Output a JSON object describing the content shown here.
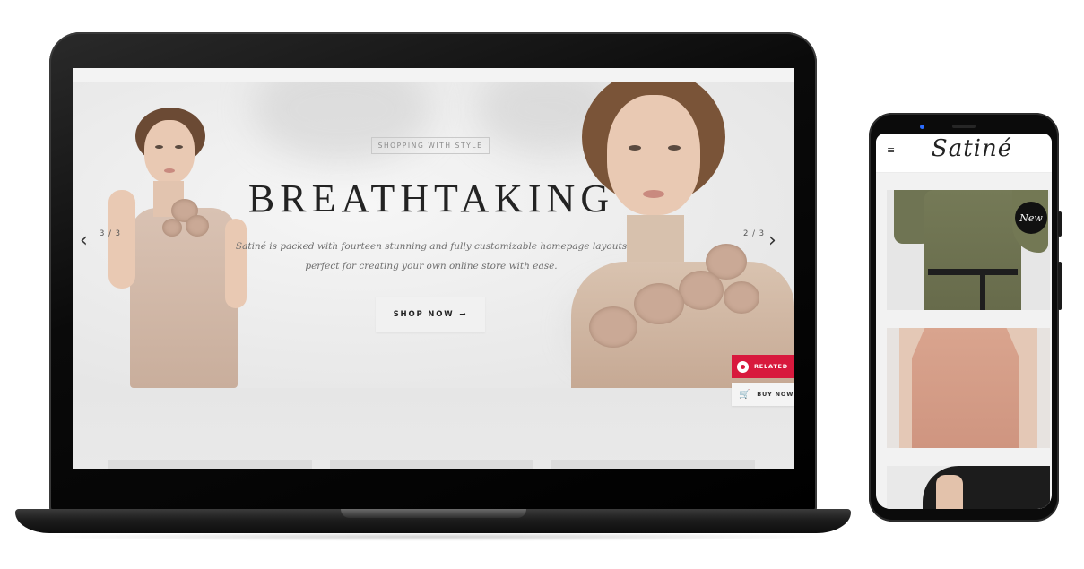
{
  "hero": {
    "kicker": "SHOPPING WITH STYLE",
    "title": "BREATHTAKING",
    "description_line1": "Satiné is packed with fourteen stunning and fully customizable homepage layouts",
    "description_line2": "perfect for creating your own online store with ease.",
    "cta_label": "SHOP NOW",
    "cta_icon": "arrow-right-icon",
    "prev_arrow": "‹",
    "next_arrow": "›",
    "slide_count_left": "3 / 3",
    "slide_count_right": "2 / 3"
  },
  "floating": {
    "related_label": "RELATED",
    "buy_label": "BUY NOW"
  },
  "phone": {
    "menu_icon": "≡",
    "brand": "Satiné",
    "badge": "New"
  },
  "colors": {
    "accent": "#d8193d",
    "text_dark": "#232323",
    "badge_bg": "#111111"
  }
}
